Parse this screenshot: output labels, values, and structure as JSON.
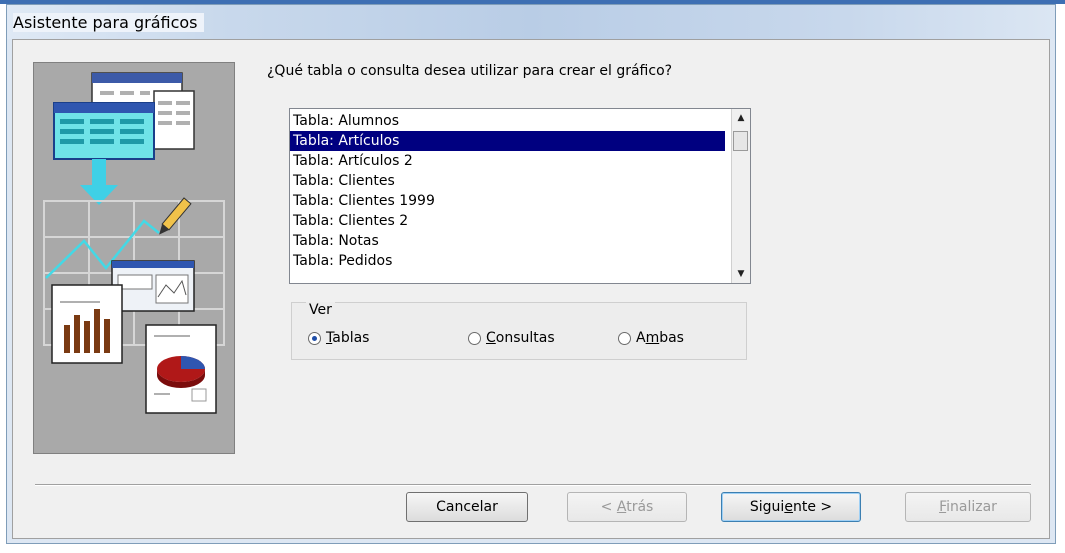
{
  "window": {
    "title": "Asistente para gráficos"
  },
  "prompt": {
    "question": "¿Qué tabla o consulta desea utilizar para crear el gráfico?"
  },
  "list": {
    "items": [
      "Tabla: Alumnos",
      "Tabla: Artículos",
      "Tabla: Artículos 2",
      "Tabla: Clientes",
      "Tabla: Clientes 1999",
      "Tabla: Clientes 2",
      "Tabla: Notas",
      "Tabla: Pedidos"
    ],
    "selected_index": 1
  },
  "view_group": {
    "label": "Ver",
    "options": [
      {
        "pre": "",
        "mnemonic": "T",
        "post": "ablas",
        "selected": true
      },
      {
        "pre": "",
        "mnemonic": "C",
        "post": "onsultas",
        "selected": false
      },
      {
        "pre": "A",
        "mnemonic": "m",
        "post": "bas",
        "selected": false
      }
    ]
  },
  "buttons": {
    "cancel": "Cancelar",
    "back": {
      "pre": "< ",
      "mnemonic": "A",
      "post": "trás"
    },
    "next": {
      "pre": "Sigui",
      "mnemonic": "e",
      "post": "nte >"
    },
    "finish": {
      "pre": "",
      "mnemonic": "F",
      "post": "inalizar"
    }
  },
  "colors": {
    "selection": "#000080",
    "accent": "#3e6fb3"
  }
}
